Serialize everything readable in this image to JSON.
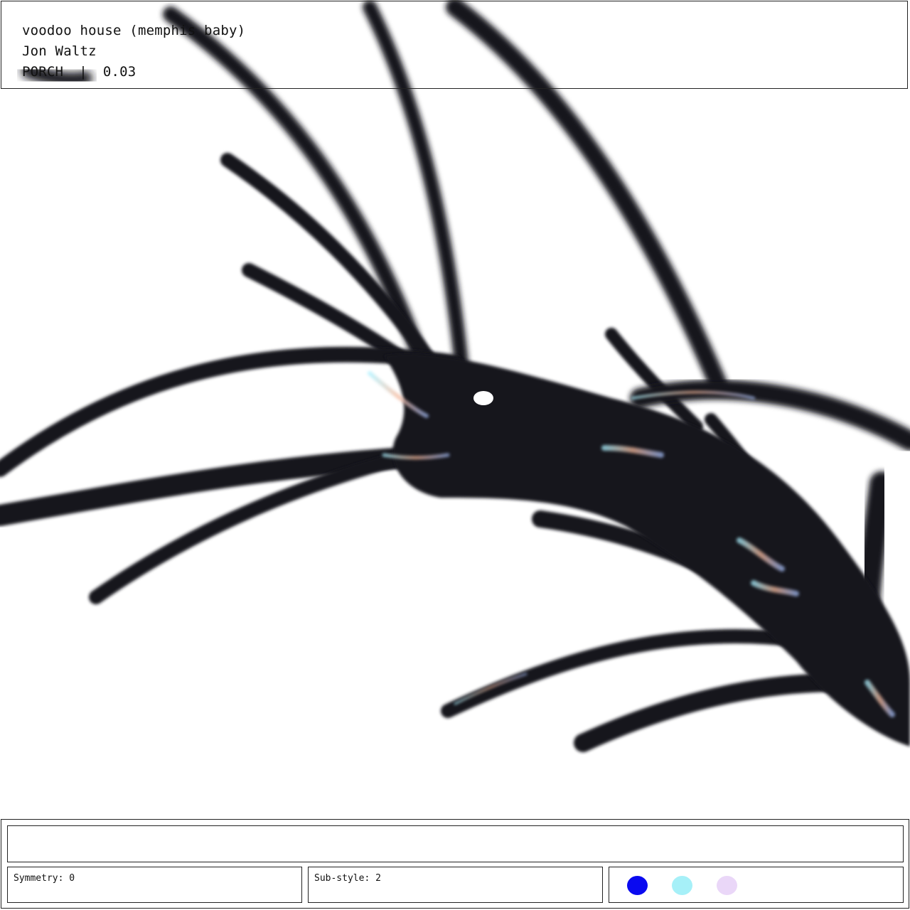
{
  "header": {
    "title": "voodoo house (memphis baby)",
    "artist": "Jon Waltz",
    "token": "PORCH",
    "separator": "|",
    "price": "0.03"
  },
  "footer": {
    "input_value": "",
    "symmetry": "Symmetry: 0",
    "substyle": "Sub-style: 2",
    "palette": [
      {
        "name": "blue-swatch",
        "color": "#0a0af0"
      },
      {
        "name": "cyan-swatch",
        "color": "#a6f0f8"
      },
      {
        "name": "lavender-swatch",
        "color": "#ead7f8"
      }
    ]
  }
}
